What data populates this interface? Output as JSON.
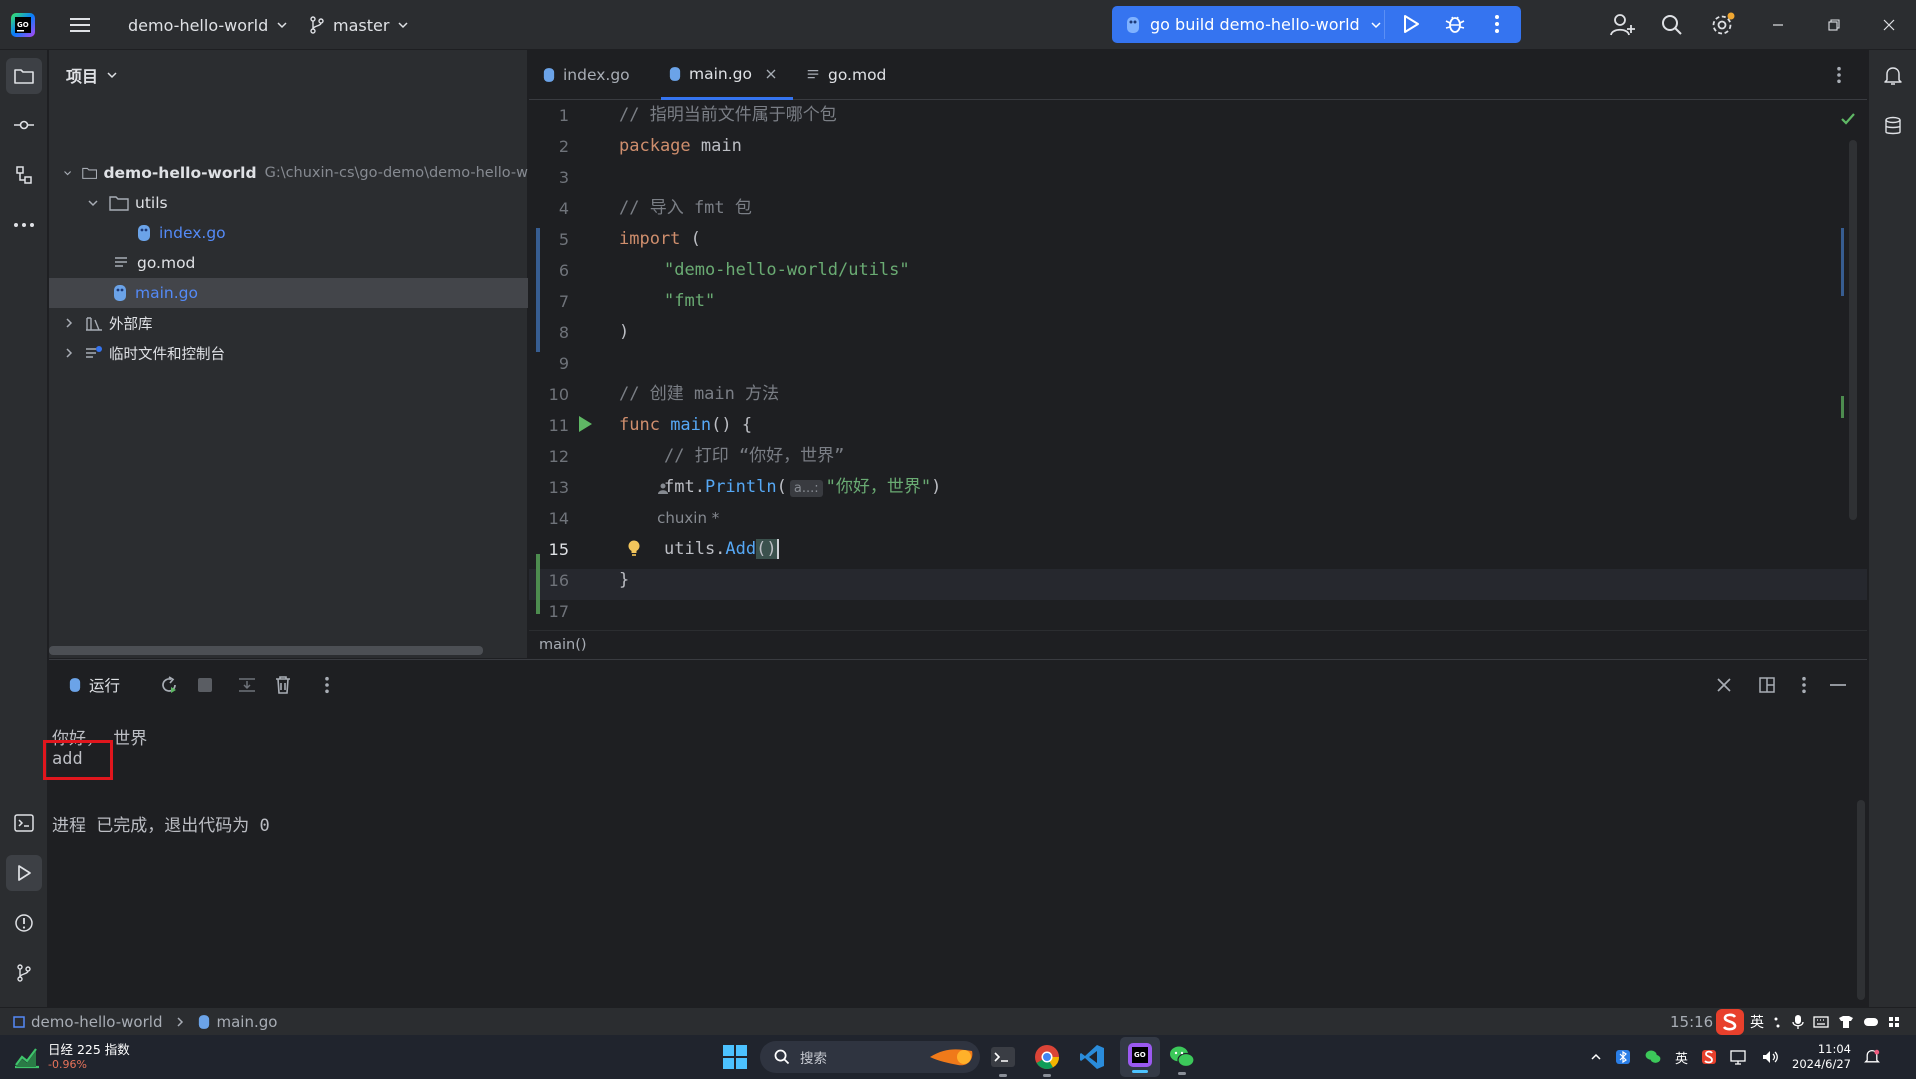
{
  "titlebar": {
    "project_name": "demo-hello-world",
    "branch": "master",
    "run_config": "go build demo-hello-world"
  },
  "project_panel": {
    "title": "项目",
    "root_name": "demo-hello-world",
    "root_path": "G:\\chuxin-cs\\go-demo\\demo-hello-w",
    "utils_folder": "utils",
    "index_file": "index.go",
    "gomod_file": "go.mod",
    "main_file": "main.go",
    "external_libs": "外部库",
    "scratches": "临时文件和控制台"
  },
  "editor": {
    "tabs": [
      "index.go",
      "main.go",
      "go.mod"
    ],
    "line_numbers": [
      "1",
      "2",
      "3",
      "4",
      "5",
      "6",
      "7",
      "8",
      "9",
      "10",
      "11",
      "12",
      "13",
      "14",
      "15",
      "16",
      "17"
    ],
    "author_hint": "chuxin *",
    "param_hint": "a...:",
    "breadcrumb": "main()",
    "code": {
      "l1": "// 指明当前文件属于哪个包",
      "l2_kw": "package",
      "l2_name": " main",
      "l4": "// 导入 fmt 包",
      "l5_kw": "import",
      "l5_rest": " (",
      "l6": "\"demo-hello-world/utils\"",
      "l7": "\"fmt\"",
      "l8": ")",
      "l10": "// 创建 main 方法",
      "l11_kw": "func",
      "l11_fn": " main",
      "l11_rest": "() {",
      "l12": "// 打印 “你好，世界”",
      "l13_a": "fmt.",
      "l13_fn": "Println",
      "l13_b": "(",
      "l13_str": "\"你好，世界\"",
      "l13_c": ")",
      "l15_a": "utils.",
      "l15_fn": "Add",
      "l15_b": "()",
      "l16": "}"
    }
  },
  "run_panel": {
    "tab_label": "运行",
    "output_line1": "你好， 世界",
    "output_line2": "add",
    "output_exit": "进程 已完成，退出代码为 0"
  },
  "statusbar": {
    "crumb_project": "demo-hello-world",
    "crumb_file": "main.go",
    "position": "15:16"
  },
  "taskbar": {
    "stock_name": "日经 225 指数",
    "stock_change": "-0.96%",
    "search_placeholder": "搜索",
    "ime": "英",
    "tray_ime": "英",
    "time": "11:04",
    "date": "2024/6/27"
  },
  "colors": {
    "accent": "#3574f0",
    "background": "#1e1f22",
    "panel": "#2b2d30",
    "highlight_box": "#e0161d"
  }
}
